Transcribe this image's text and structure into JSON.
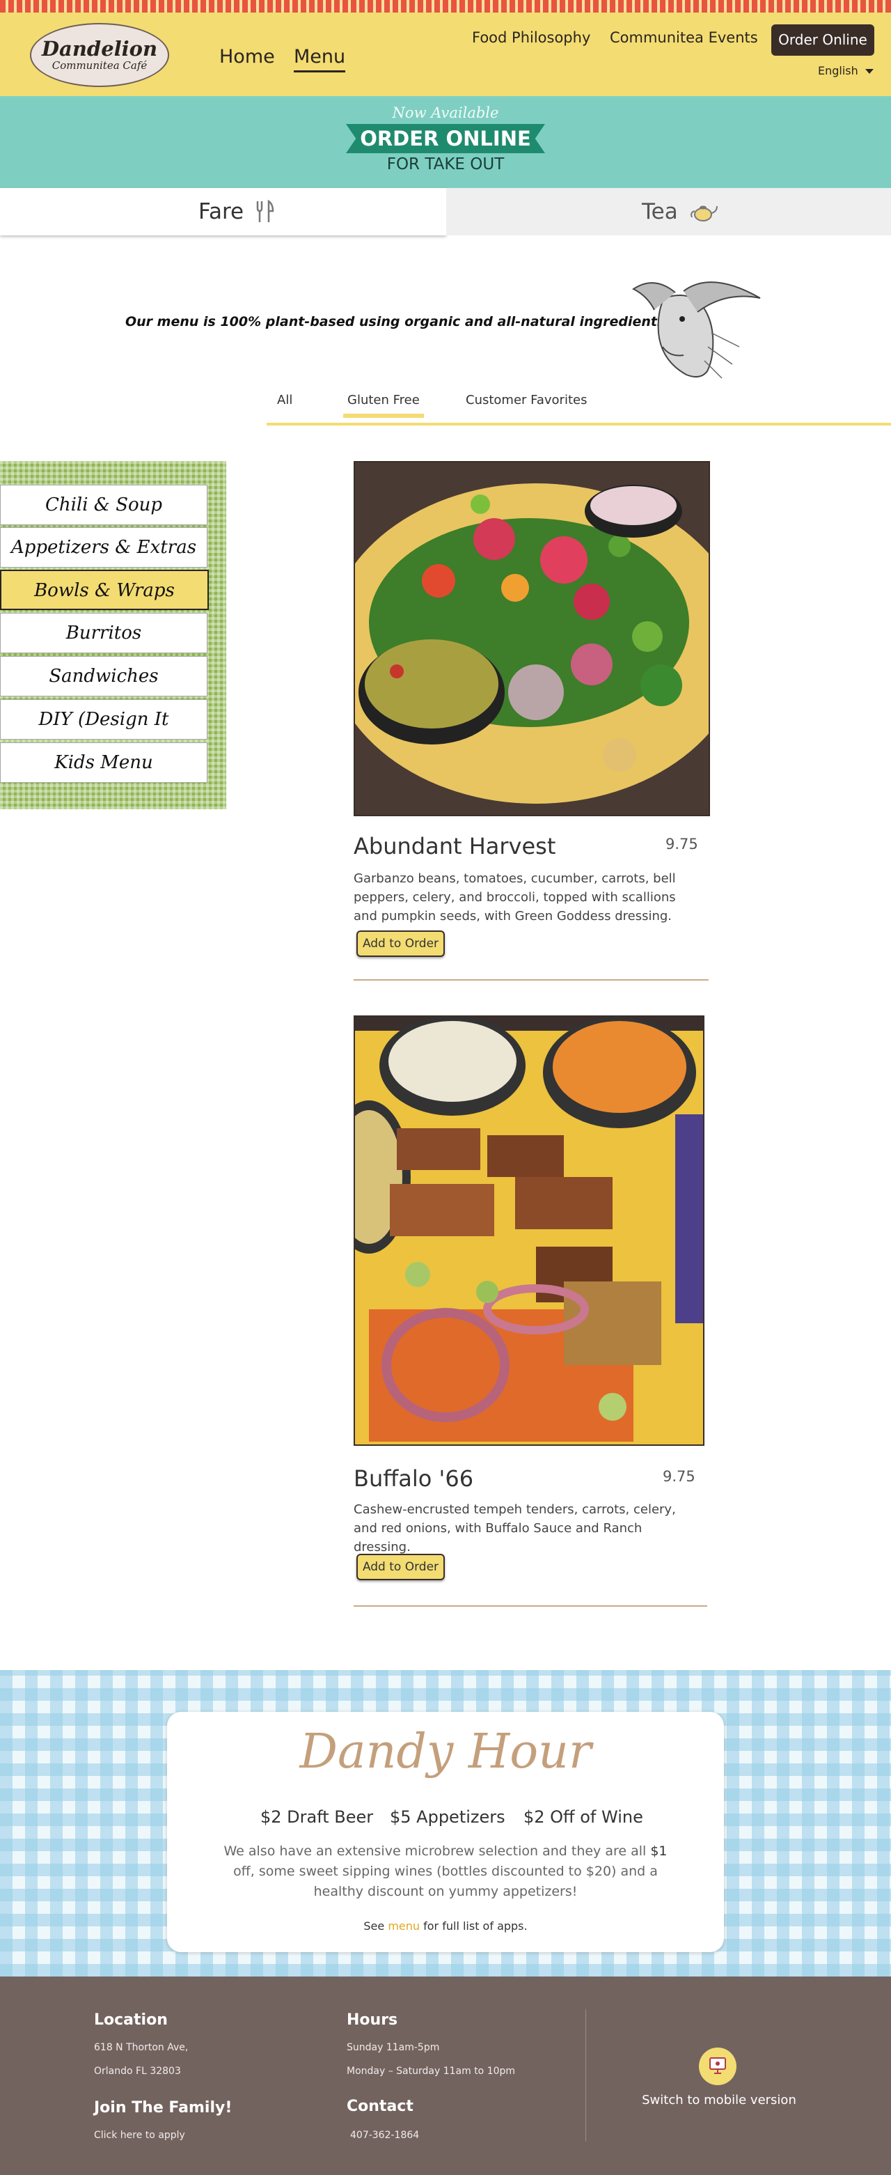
{
  "header": {
    "logo_title": "Dandelion",
    "logo_subtitle": "Communitea Café",
    "nav": {
      "home": "Home",
      "menu": "Menu",
      "philosophy": "Food Philosophy",
      "events": "Communitea Events"
    },
    "order_button": "Order Online",
    "language": "English"
  },
  "banner": {
    "now_available": "Now Available",
    "order_online": "ORDER ONLINE",
    "take_out": "FOR TAKE OUT"
  },
  "tabs": {
    "fare": "Fare",
    "tea": "Tea"
  },
  "intro": "Our menu is 100% plant-based using organic and all-natural ingredients",
  "filters": {
    "all": "All",
    "gluten_free": "Gluten Free",
    "favorites": "Customer Favorites",
    "active": "Gluten Free"
  },
  "categories": [
    {
      "label": "Chili & Soup"
    },
    {
      "label": "Appetizers & Extras"
    },
    {
      "label": "Bowls & Wraps",
      "active": true
    },
    {
      "label": "Burritos"
    },
    {
      "label": "Sandwiches"
    },
    {
      "label": "DIY (Design It Yourself)"
    },
    {
      "label": "Kids Menu"
    }
  ],
  "items": [
    {
      "name": "Abundant Harvest",
      "price": "9.75",
      "description": "Garbanzo beans, tomatoes, cucumber, carrots, bell peppers, celery, and broccoli, topped with scallions and pumpkin seeds, with Green Goddess dressing.",
      "button": "Add to Order"
    },
    {
      "name": "Buffalo '66",
      "price": "9.75",
      "description": "Cashew-encrusted tempeh tenders, carrots, celery, and red onions, with Buffalo Sauce and Ranch dressing.",
      "button": "Add to Order"
    }
  ],
  "dandy_hour": {
    "title": "Dandy Hour",
    "specials": [
      "$2 Draft Beer",
      "$5 Appetizers",
      "$2 Off of Wine"
    ],
    "desc_before": "We also have an extensive microbrew selection and they are all ",
    "desc_highlight": "$1",
    "desc_after": " off, some sweet sipping wines (bottles discounted to $20) and a healthy discount on yummy appetizers!",
    "see_prefix": "See ",
    "see_link": "menu",
    "see_suffix": " for full list of apps."
  },
  "footer": {
    "location_title": "Location",
    "address_line1": "618 N Thorton Ave,",
    "address_line2": "Orlando FL 32803",
    "hours_title": "Hours",
    "hours_line1": "Sunday 11am-5pm",
    "hours_line2": "Monday – Saturday 11am to 10pm",
    "join_title": "Join The Family!",
    "join_link": "Click here to apply",
    "contact_title": "Contact",
    "phone": "407-362-1864",
    "mobile_switch": "Switch to mobile version"
  },
  "colors": {
    "header_yellow": "#f3dc72",
    "teal": "#7ecfc2",
    "footer_brown": "#73635f",
    "accent_tan": "#c49f7b",
    "sidebar_green": "#8fb552"
  }
}
